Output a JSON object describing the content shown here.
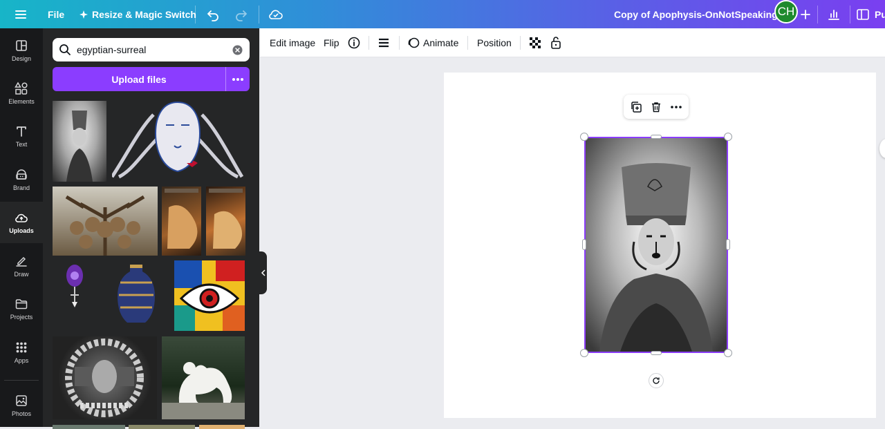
{
  "topbar": {
    "file_label": "File",
    "resize_label": "Resize & Magic Switch",
    "doc_title": "Copy of Apophysis-OnNotSpeaking",
    "avatar_initials": "CH",
    "publish_label": "Pu"
  },
  "rail": {
    "items": [
      {
        "label": "Design",
        "icon": "design-icon"
      },
      {
        "label": "Elements",
        "icon": "elements-icon"
      },
      {
        "label": "Text",
        "icon": "text-icon"
      },
      {
        "label": "Brand",
        "icon": "brand-icon"
      },
      {
        "label": "Uploads",
        "icon": "upload-cloud-icon",
        "active": true
      },
      {
        "label": "Draw",
        "icon": "draw-icon"
      },
      {
        "label": "Projects",
        "icon": "folder-icon"
      },
      {
        "label": "Apps",
        "icon": "apps-grid-icon"
      },
      {
        "label": "Photos",
        "icon": "photos-icon"
      }
    ]
  },
  "panel": {
    "search_value": "egyptian-surreal",
    "upload_label": "Upload files"
  },
  "toolbar": {
    "edit_image": "Edit image",
    "flip": "Flip",
    "animate": "Animate",
    "position": "Position"
  },
  "colors": {
    "accent": "#8b3dff",
    "panel_bg": "#252627",
    "rail_bg": "#18191b",
    "avatar": "#1e8a2e"
  }
}
